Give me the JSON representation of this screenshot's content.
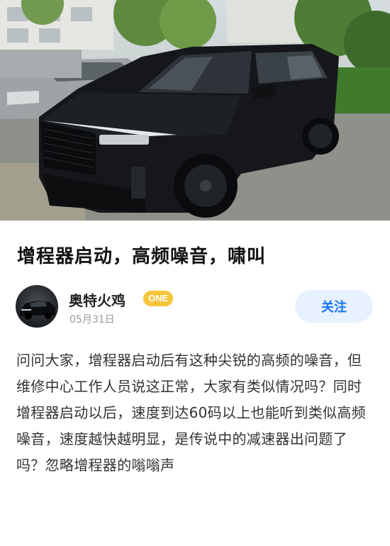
{
  "post": {
    "title": "增程器启动，高频噪音，啸叫",
    "author": {
      "name": "奥特火鸡",
      "badge": "ONE",
      "date": "05月31日"
    },
    "follow_label": "关注",
    "body": "问问大家，增程器启动后有这种尖锐的高频的噪音，但维修中心工作人员说这正常，大家有类似情况吗？同时增程器启动以后，速度到达60码以上也能听到类似高频噪音，速度越快越明显，是传说中的减速器出问题了吗？忽略增程器的嗡嗡声"
  },
  "colors": {
    "accent": "#1677ff",
    "follow_bg": "#e7f1ff",
    "badge": "#f7c53a",
    "car": "#15171a"
  }
}
